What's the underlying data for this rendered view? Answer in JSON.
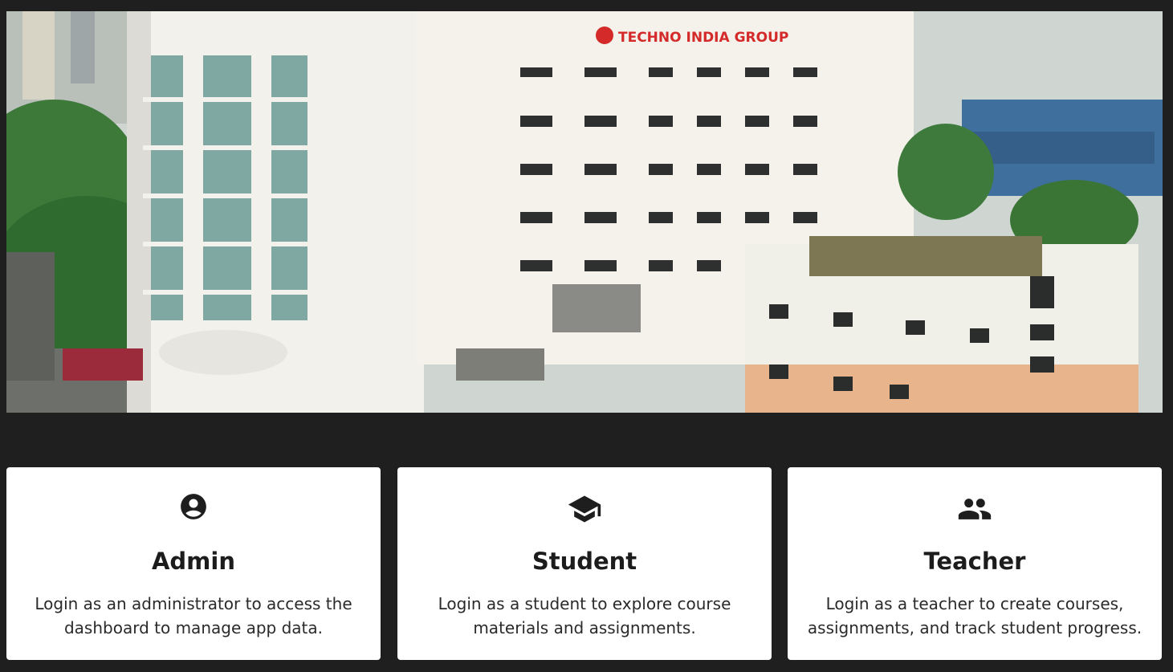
{
  "hero": {
    "sign_text": "TECHNO INDIA GROUP",
    "alt": "campus-building-photo"
  },
  "cards": [
    {
      "icon": "account-circle-icon",
      "title": "Admin",
      "description": "Login as an administrator to access the dashboard to manage app data."
    },
    {
      "icon": "graduation-cap-icon",
      "title": "Student",
      "description": "Login as a student to explore course materials and assignments."
    },
    {
      "icon": "people-icon",
      "title": "Teacher",
      "description": "Login as a teacher to create courses, assignments, and track student progress."
    }
  ],
  "colors": {
    "background": "#1f1f1f",
    "card": "#ffffff",
    "text": "#1c1c1c"
  }
}
